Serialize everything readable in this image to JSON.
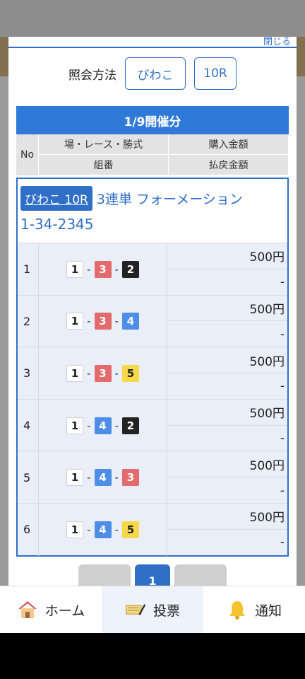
{
  "modal": {
    "close_label": "閉じる",
    "query_label": "照会方法",
    "query_venue": "びわこ",
    "query_race": "10R"
  },
  "table": {
    "date_header": "1/9開催分",
    "col_no": "No",
    "col_venue_race_type": "場・レース・勝式",
    "col_purchase": "購入金額",
    "col_combination": "組番",
    "col_refund": "払戻金額"
  },
  "ticket": {
    "venue_race": "びわこ 10R",
    "bet_type": "3連単 フォーメーション",
    "combination": "1-34-2345",
    "rows": [
      {
        "no": "1",
        "c1": "1",
        "c2": "3",
        "c3": "2",
        "amount": "500円",
        "refund": "-"
      },
      {
        "no": "2",
        "c1": "1",
        "c2": "3",
        "c3": "4",
        "amount": "500円",
        "refund": "-"
      },
      {
        "no": "3",
        "c1": "1",
        "c2": "3",
        "c3": "5",
        "amount": "500円",
        "refund": "-"
      },
      {
        "no": "4",
        "c1": "1",
        "c2": "4",
        "c3": "2",
        "amount": "500円",
        "refund": "-"
      },
      {
        "no": "5",
        "c1": "1",
        "c2": "4",
        "c3": "3",
        "amount": "500円",
        "refund": "-"
      },
      {
        "no": "6",
        "c1": "1",
        "c2": "4",
        "c3": "5",
        "amount": "500円",
        "refund": "-"
      }
    ]
  },
  "pager": {
    "current": "1"
  },
  "nav": {
    "home": "ホーム",
    "vote": "投票",
    "notice": "通知"
  },
  "colors": {
    "accent": "#2f6fc8",
    "boat_1": "#ffffff",
    "boat_2": "#222222",
    "boat_3": "#e46b6b",
    "boat_4": "#4f8ee8",
    "boat_5": "#f5d948"
  }
}
